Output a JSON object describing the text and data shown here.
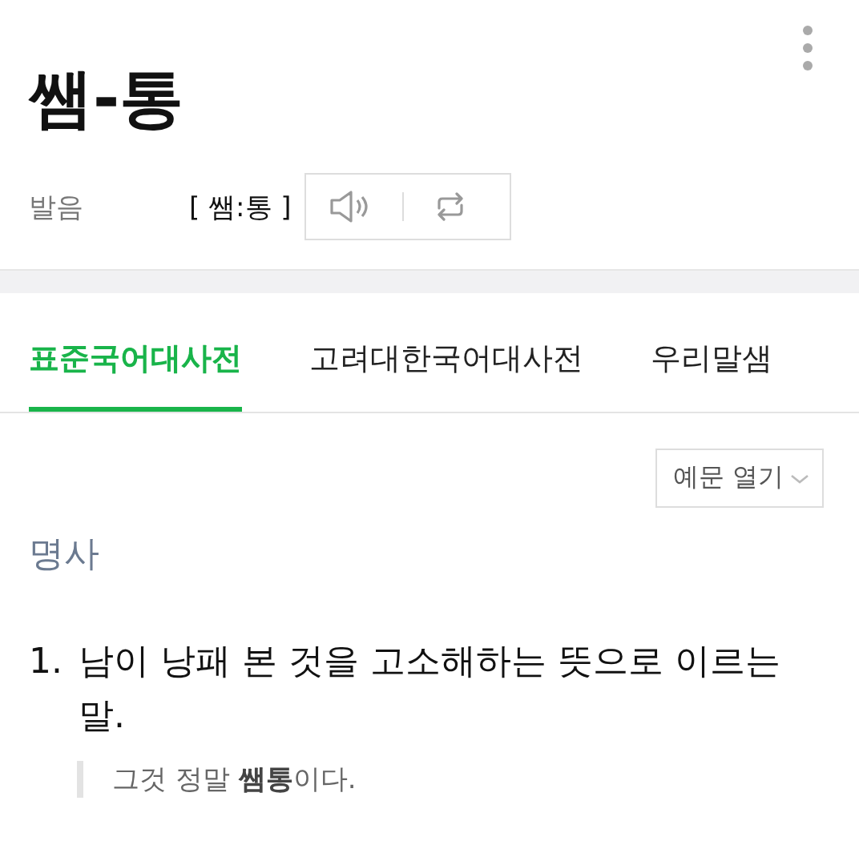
{
  "headword": "쌤-통",
  "pronunciation": {
    "label": "발음",
    "text": "[ 쌤:통 ]"
  },
  "tabs": [
    {
      "label": "표준국어대사전",
      "selected": true
    },
    {
      "label": "고려대한국어대사전",
      "selected": false
    },
    {
      "label": "우리말샘",
      "selected": false
    }
  ],
  "example_toggle": "예문 열기",
  "part_of_speech": "명사",
  "definitions": [
    {
      "number": "1.",
      "text": "남이 낭패 본 것을 고소해하는 뜻으로 이르는 말.",
      "example": "그것 정말 **쌤통**이다."
    }
  ]
}
